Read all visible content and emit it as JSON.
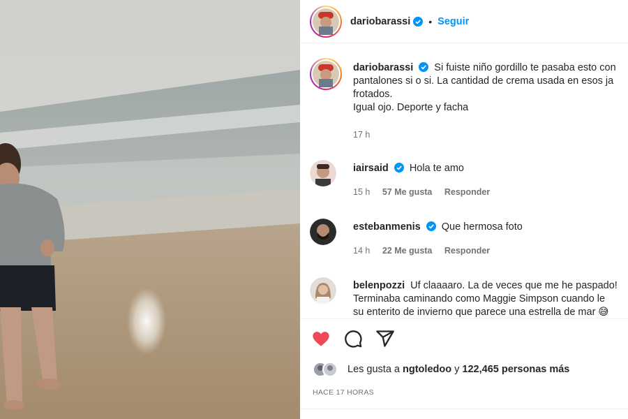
{
  "colors": {
    "link_blue": "#0095f6",
    "like_red": "#ed4956",
    "text": "#262626",
    "muted": "#737373"
  },
  "header": {
    "username": "dariobarassi",
    "follow_label": "Seguir",
    "verified_icon": "verified-badge-icon"
  },
  "caption": {
    "username": "dariobarassi",
    "lines": [
      "Si fuiste niño gordillo te pasaba esto con",
      "pantalones si o si. La cantidad de crema usada en esos ja",
      "frotados.",
      "Igual ojo. Deporte y facha"
    ],
    "time": "17 h"
  },
  "comments": [
    {
      "username": "iairsaid",
      "text": "Hola te amo",
      "time": "15 h",
      "likes": "57 Me gusta",
      "reply": "Responder"
    },
    {
      "username": "estebanmenis",
      "text": "Que hermosa foto",
      "time": "14 h",
      "likes": "22 Me gusta",
      "reply": "Responder"
    },
    {
      "username": "belenpozzi",
      "lines": [
        "Uf claaaaro. La de veces que me he paspado!",
        "Terminaba caminando como Maggie Simpson cuando le",
        "su enterito de invierno que parece una estrella de mar 😅"
      ]
    }
  ],
  "actions": {
    "icons": [
      "heart-icon",
      "comment-icon",
      "share-icon"
    ],
    "liked": true
  },
  "likes_line": {
    "prefix": "Les gusta a",
    "user": "ngtoledoo",
    "joiner": "y",
    "count": "122,465 personas más"
  },
  "posted_ago": "HACE 17 HORAS"
}
